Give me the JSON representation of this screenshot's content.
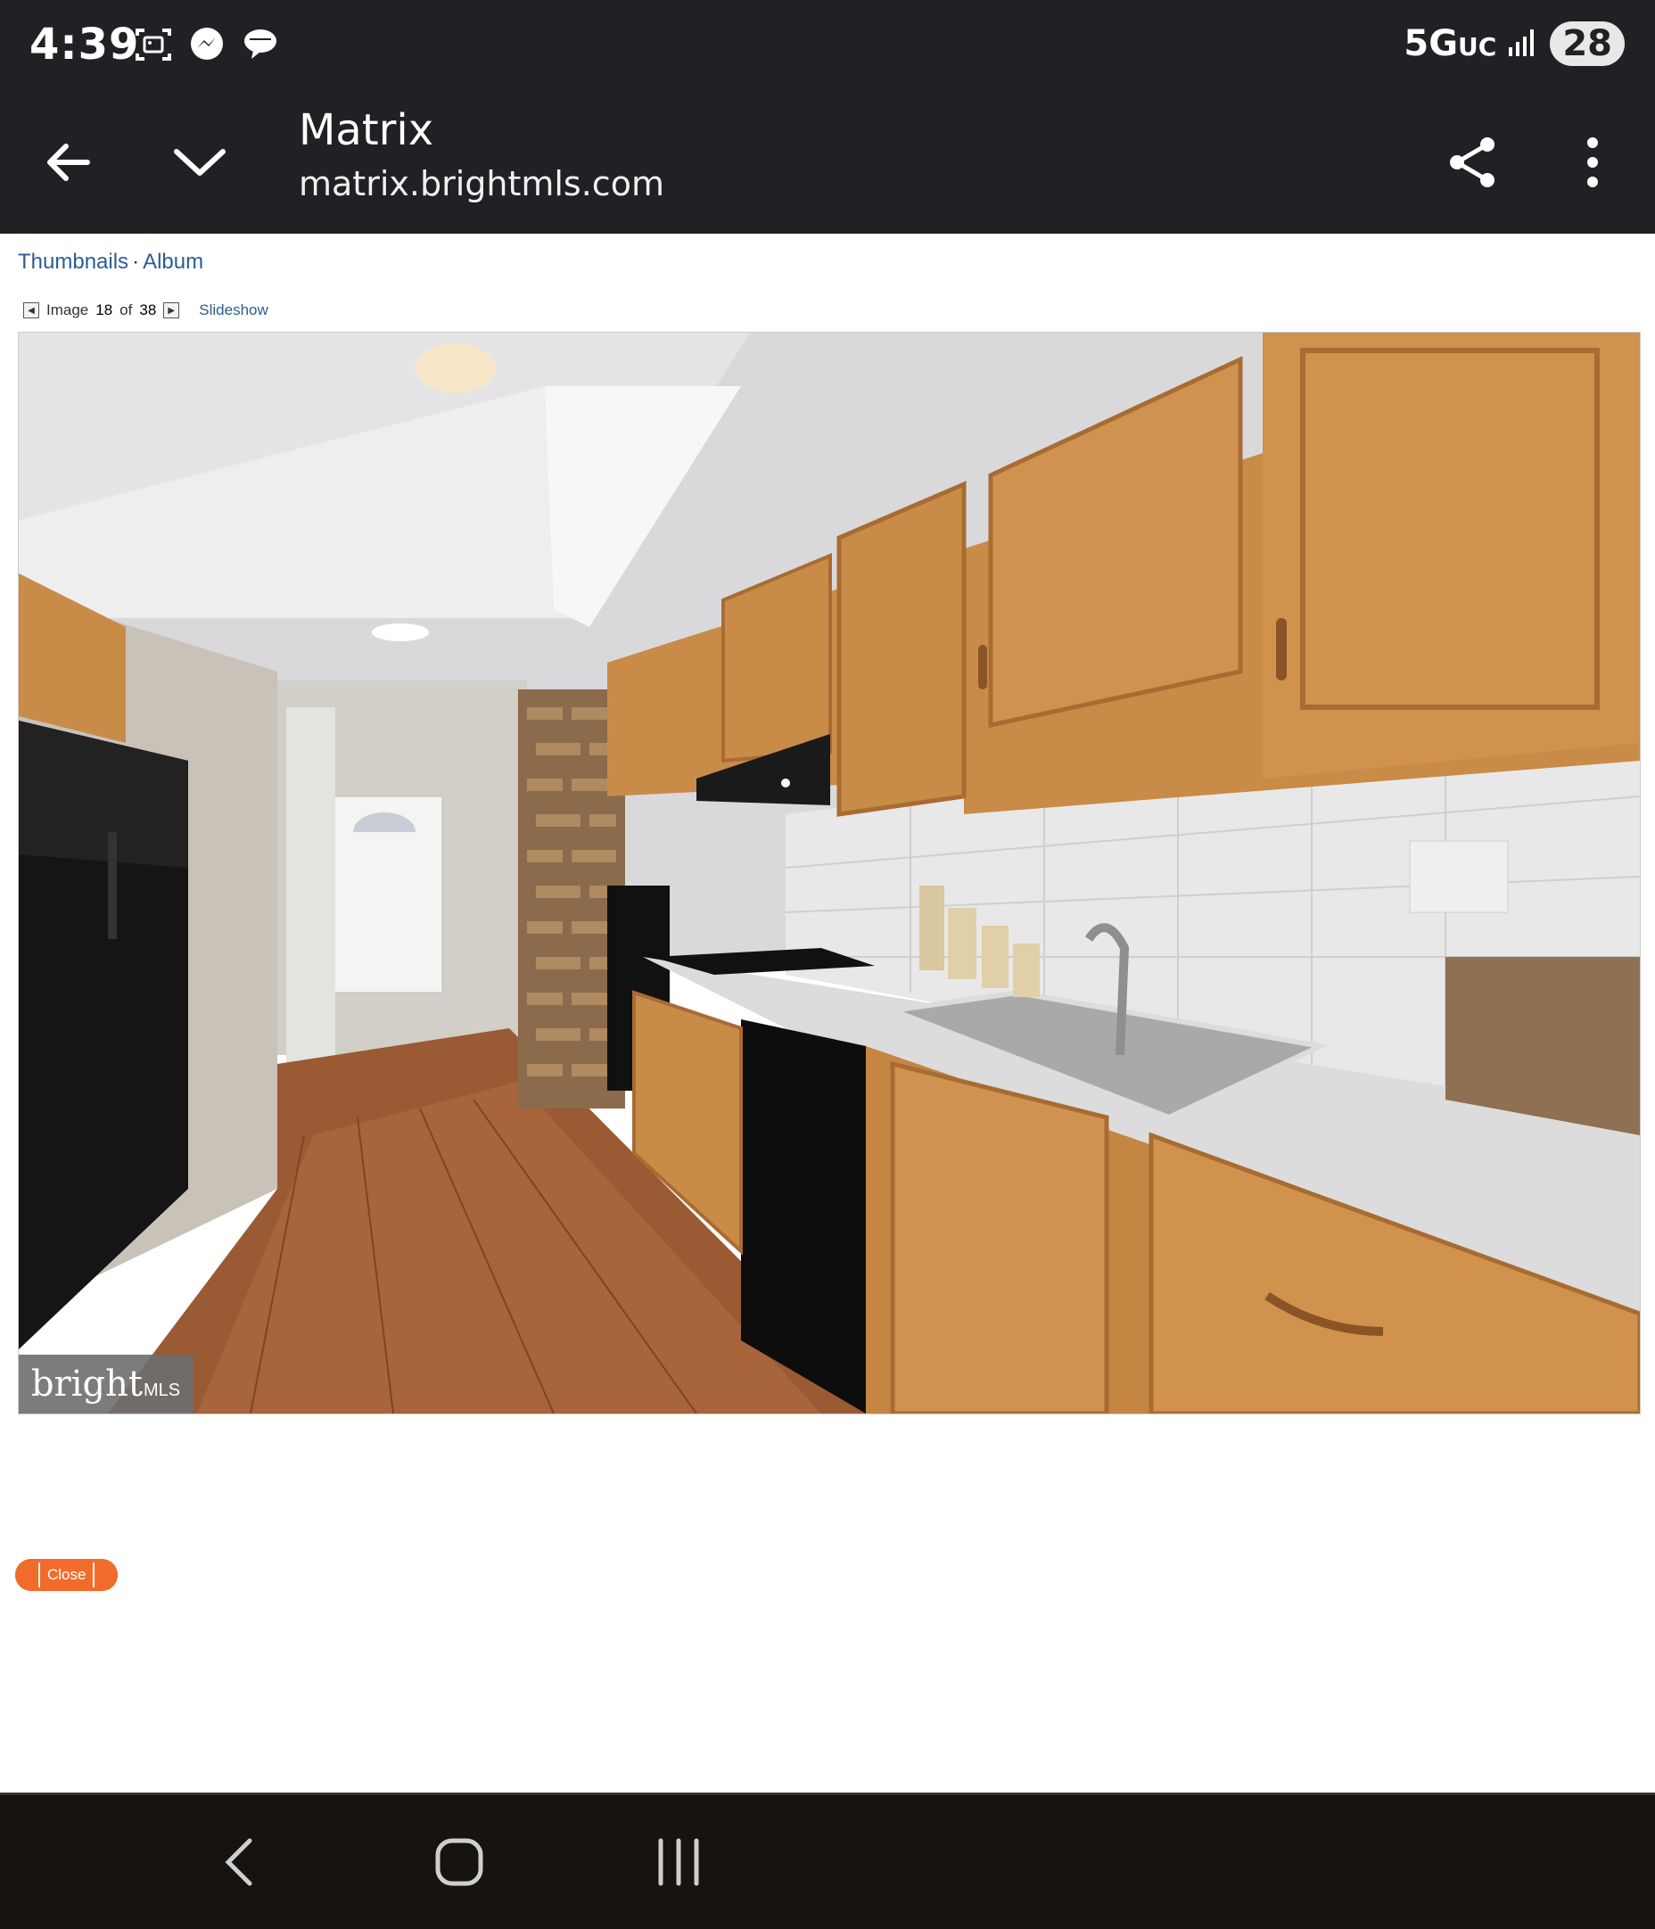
{
  "status_bar": {
    "time": "4:39",
    "notification_icons": [
      "screenshot-icon",
      "messenger-icon",
      "chat-bubble-icon"
    ],
    "network": "5G",
    "network_suffix": "UC",
    "battery": "28"
  },
  "toolbar": {
    "title": "Matrix",
    "url": "matrix.brightmls.com"
  },
  "breadcrumbs": {
    "thumbnails": "Thumbnails",
    "separator": "·",
    "album": "Album"
  },
  "pager": {
    "image_label": "Image",
    "current": "18",
    "of_label": "of",
    "total": "38",
    "slideshow": "Slideshow"
  },
  "photo": {
    "watermark_brand": "bright",
    "watermark_suffix": "MLS"
  },
  "close_label": "Close",
  "colors": {
    "chrome": "#202125",
    "link": "#2a5d94",
    "close_button": "#f26b2a",
    "nav_bar": "#161310"
  }
}
